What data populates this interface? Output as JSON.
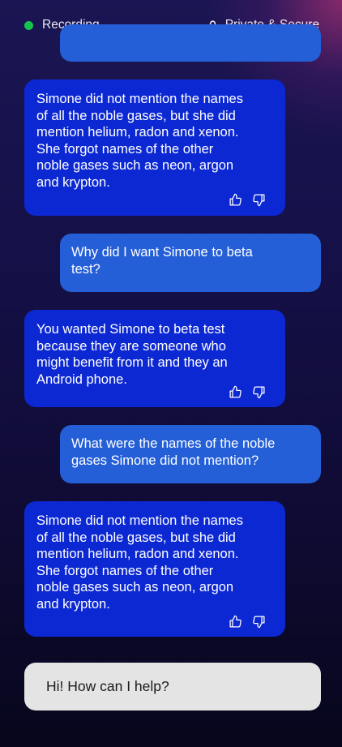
{
  "status_bar": {
    "recording_label": "Recording",
    "recording_color": "#15c24b",
    "secure_label": "Private & Secure",
    "secure_icon": "lock-icon"
  },
  "messages": [
    {
      "role": "user",
      "text": ""
    },
    {
      "role": "assistant",
      "text": "Simone did not mention the names\nof all the noble gases, but she did\nmention helium, radon and xenon.\nShe forgot names of the other\nnoble gases such as neon, argon\nand krypton."
    },
    {
      "role": "user",
      "text": "Why did I want Simone to beta\ntest?"
    },
    {
      "role": "assistant",
      "text": "You wanted Simone to beta test\nbecause they are someone who\nmight benefit from it and they an\nAndroid phone."
    },
    {
      "role": "user",
      "text": "What were the names of the noble\ngases Simone did not mention?"
    },
    {
      "role": "assistant",
      "text": "Simone did not mention the names\nof all the noble gases, but she did\nmention helium, radon and xenon.\nShe forgot names of the other\nnoble gases such as neon, argon\nand krypton."
    }
  ],
  "feedback_icons": [
    "thumbs-up-icon",
    "thumbs-down-icon"
  ],
  "input": {
    "placeholder": "Hi! How can I help?"
  },
  "colors": {
    "assistant_bubble": "#0c28d3",
    "user_bubble": "#245fd8",
    "input_background": "#e4e4e4"
  }
}
